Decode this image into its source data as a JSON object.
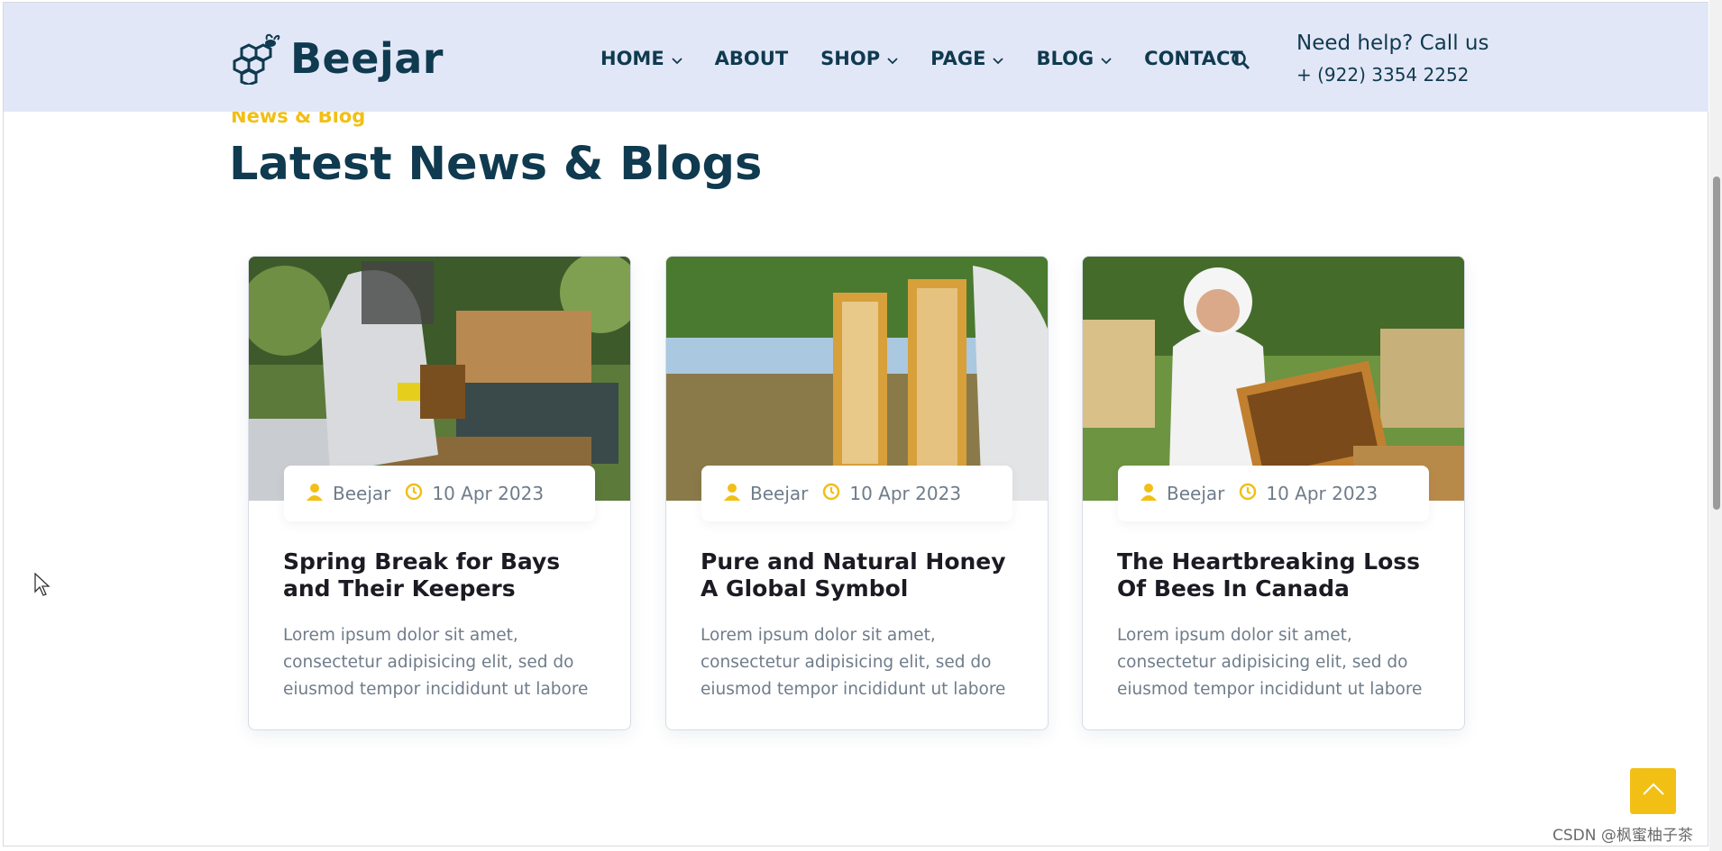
{
  "header": {
    "logo_text": "Beejar",
    "nav": [
      {
        "label": "HOME",
        "dropdown": true
      },
      {
        "label": "ABOUT",
        "dropdown": false
      },
      {
        "label": "SHOP",
        "dropdown": true
      },
      {
        "label": "PAGE",
        "dropdown": true
      },
      {
        "label": "BLOG",
        "dropdown": true
      },
      {
        "label": "CONTACT",
        "dropdown": false
      }
    ],
    "search_icon": "search-icon",
    "help_title": "Need help? Call us",
    "help_phone": "+ (922) 3354 2252"
  },
  "section": {
    "kicker": "News & Blog",
    "title": "Latest News & Blogs"
  },
  "posts": [
    {
      "image": "beekeeper-inspecting-frame-photo",
      "author": "Beejar",
      "date": "10 Apr 2023",
      "title": "Spring Break for Bays and Their Keepers",
      "excerpt": "Lorem ipsum dolor sit amet, consectetur adipisicing elit, sed do eiusmod tempor incididunt ut labore"
    },
    {
      "image": "honeycomb-frames-photo",
      "author": "Beejar",
      "date": "10 Apr 2023",
      "title": "Pure and Natural Honey A Global Symbol",
      "excerpt": "Lorem ipsum dolor sit amet, consectetur adipisicing elit, sed do eiusmod tempor incididunt ut labore"
    },
    {
      "image": "smiling-beekeeper-photo",
      "author": "Beejar",
      "date": "10 Apr 2023",
      "title": "The Heartbreaking Loss Of Bees In Canada",
      "excerpt": "Lorem ipsum dolor sit amet, consectetur adipisicing elit, sed do eiusmod tempor incididunt ut labore"
    }
  ],
  "colors": {
    "accent": "#f2bf14",
    "navy": "#0f3a4f",
    "header_bg": "#e2e7f7"
  },
  "watermark": "CSDN @枫蜜柚子茶"
}
